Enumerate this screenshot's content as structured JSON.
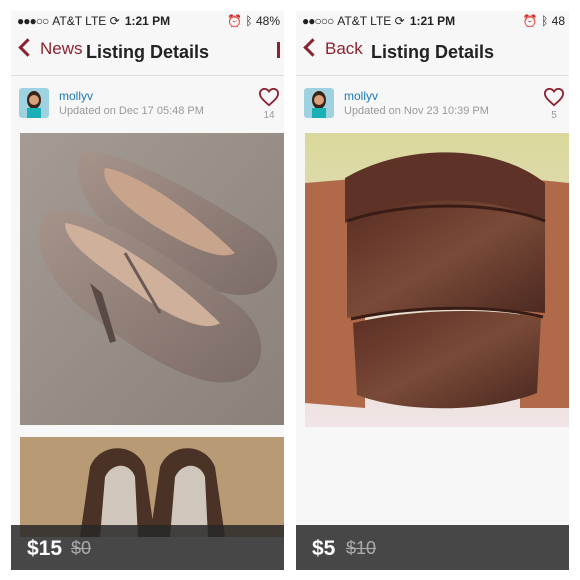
{
  "screens": [
    {
      "status": {
        "carrier": "AT&T",
        "network": "LTE",
        "time": "1:21 PM",
        "battery": "48%"
      },
      "nav": {
        "back_label": "News",
        "title": "Listing Details"
      },
      "user": {
        "name": "mollyv",
        "updated": "Updated on Dec 17 05:48 PM"
      },
      "likes": "14",
      "price": "$15",
      "original_price": "$0",
      "photos": [
        "suede heels",
        "heels from above"
      ]
    },
    {
      "status": {
        "carrier": "AT&T",
        "network": "LTE",
        "time": "1:21 PM",
        "battery": "48"
      },
      "nav": {
        "back_label": "Back",
        "title": "Listing Details"
      },
      "user": {
        "name": "mollyv",
        "updated": "Updated on Nov 23 10:39 PM"
      },
      "likes": "5",
      "price": "$5",
      "original_price": "$10",
      "photos": [
        "wooden cuff bracelet"
      ]
    }
  ],
  "colors": {
    "accent": "#8b2230",
    "link": "#1a78b5",
    "price_bar": "#282828"
  }
}
